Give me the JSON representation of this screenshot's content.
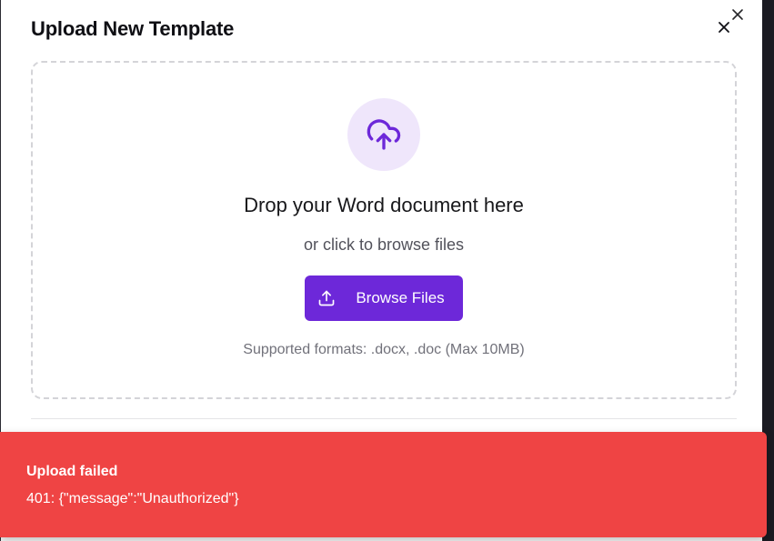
{
  "modal": {
    "title": "Upload New Template",
    "close_icon": "close-icon"
  },
  "dropzone": {
    "icon": "cloud-upload-icon",
    "title": "Drop your Word document here",
    "subtitle": "or click to browse files",
    "button_label": "Browse Files",
    "button_icon": "upload-icon",
    "formats_text": "Supported formats: .docx, .doc (Max 10MB)"
  },
  "toast": {
    "title": "Upload failed",
    "message": "401: {\"message\":\"Unauthorized\"}"
  },
  "colors": {
    "accent": "#6d28d9",
    "accent_light": "#efe6fb",
    "toast_bg": "#ef4444"
  }
}
